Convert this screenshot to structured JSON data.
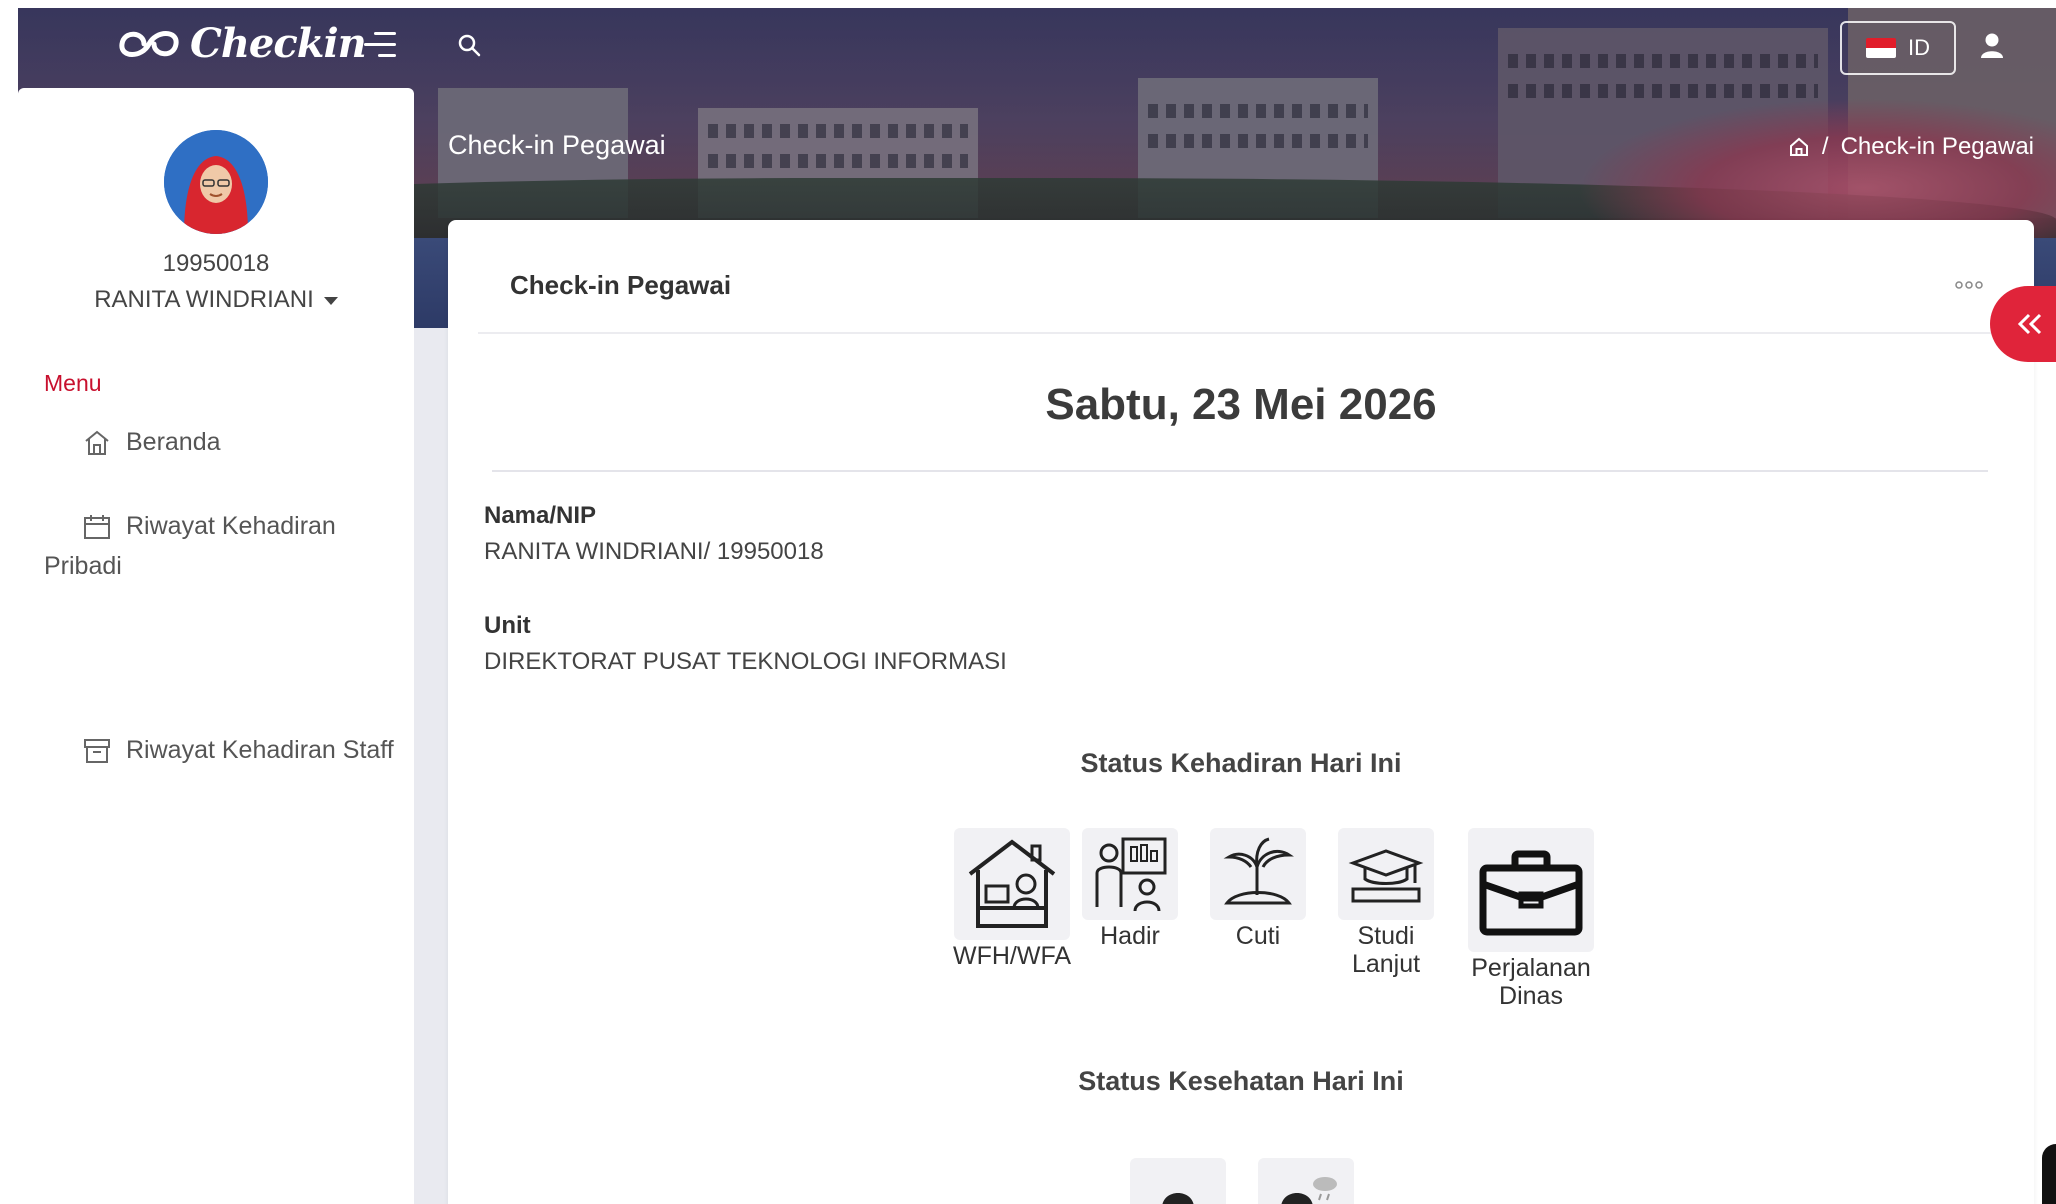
{
  "app": {
    "name": "Checkin",
    "language": "ID"
  },
  "header": {
    "page_title": "Check-in Pegawai",
    "breadcrumb": {
      "separator": "/",
      "current": "Check-in Pegawai"
    }
  },
  "user": {
    "nip": "19950018",
    "name": "RANITA WINDRIANI"
  },
  "sidebar": {
    "menu_label": "Menu",
    "items": [
      {
        "label": "Beranda",
        "icon": "home-icon"
      },
      {
        "label": "Riwayat Kehadiran",
        "label_cont": "Pribadi",
        "icon": "calendar-icon"
      },
      {
        "label": "Riwayat Kehadiran Staff",
        "icon": "archive-icon"
      }
    ]
  },
  "card": {
    "title": "Check-in Pegawai",
    "date": "Sabtu, 23 Mei 2026",
    "fields": [
      {
        "label": "Nama/NIP",
        "value": "RANITA WINDRIANI/ 19950018"
      },
      {
        "label": "Unit",
        "value": "DIREKTORAT PUSAT TEKNOLOGI INFORMASI"
      }
    ],
    "attendance_title": "Status Kehadiran Hari Ini",
    "attendance_options": [
      {
        "label": "WFH/WFA",
        "icon": "work-from-home-icon"
      },
      {
        "label": "Hadir",
        "icon": "present-teacher-icon"
      },
      {
        "label": "Cuti",
        "icon": "vacation-island-icon"
      },
      {
        "label": "Studi Lanjut",
        "icon": "graduation-cap-icon"
      },
      {
        "label": "Perjalanan Dinas",
        "icon": "briefcase-icon"
      }
    ],
    "health_title": "Status Kesehatan Hari Ini",
    "health_options": [
      {
        "icon": "healthy-person-icon"
      },
      {
        "icon": "sick-person-icon"
      }
    ]
  },
  "colors": {
    "accent": "#c8102e",
    "toggle": "#e0243a"
  }
}
